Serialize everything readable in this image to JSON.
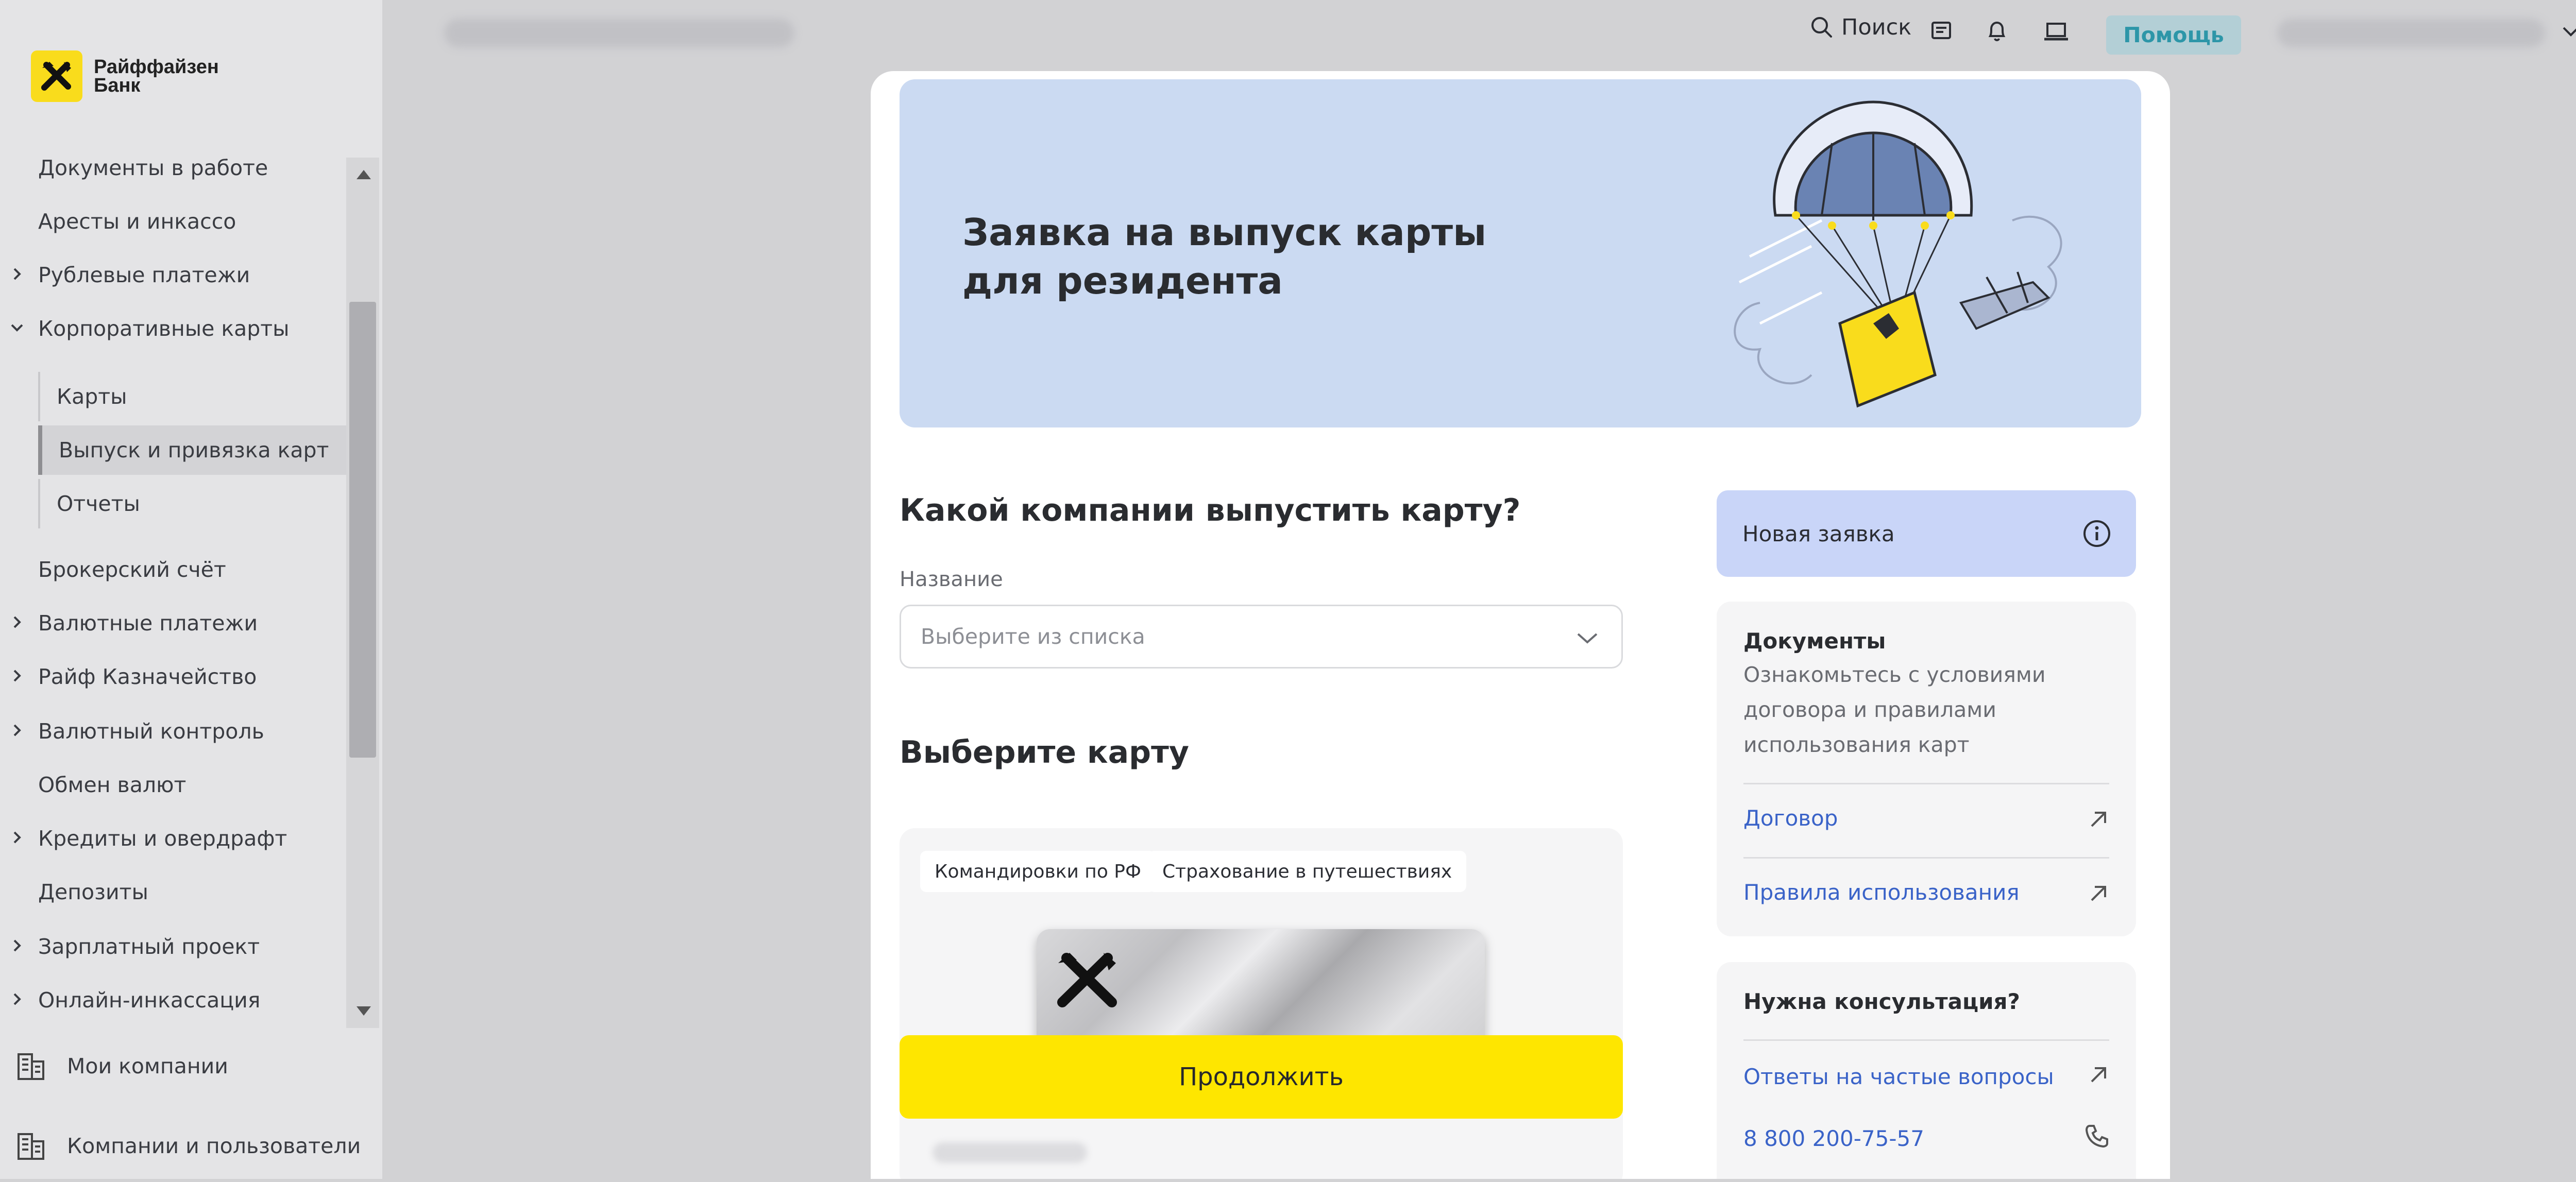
{
  "brand": {
    "name_line1": "Райффайзен",
    "name_line2": "Банк",
    "color": "#f9dc1c"
  },
  "sidebar": {
    "items": [
      {
        "label": "Документы в работе",
        "expandable": false
      },
      {
        "label": "Аресты и инкассо",
        "expandable": false
      },
      {
        "label": "Рублевые платежи",
        "expandable": true,
        "expanded": false
      },
      {
        "label": "Корпоративные карты",
        "expandable": true,
        "expanded": true
      }
    ],
    "subitems": [
      {
        "label": "Карты",
        "active": false
      },
      {
        "label": "Выпуск и привязка карт",
        "active": true
      },
      {
        "label": "Отчеты",
        "active": false
      }
    ],
    "items_after": [
      {
        "label": "Брокерский счёт",
        "expandable": false
      },
      {
        "label": "Валютные платежи",
        "expandable": true
      },
      {
        "label": "Райф Казначейство",
        "expandable": true
      },
      {
        "label": "Валютный контроль",
        "expandable": true
      },
      {
        "label": "Обмен валют",
        "expandable": false
      },
      {
        "label": "Кредиты и овердрафт",
        "expandable": true
      },
      {
        "label": "Депозиты",
        "expandable": false
      },
      {
        "label": "Зарплатный проект",
        "expandable": true
      },
      {
        "label": "Онлайн-инкассация",
        "expandable": true
      }
    ],
    "bottom": [
      {
        "label": "Мои компании",
        "icon": "building-icon"
      },
      {
        "label": "Компании и пользователи",
        "icon": "building-icon"
      }
    ]
  },
  "topbar": {
    "search_label": "Поиск",
    "help_label": "Помощь",
    "icons": [
      "search-icon",
      "chat-icon",
      "bell-icon",
      "laptop-icon",
      "chevron-down-icon"
    ]
  },
  "modal": {
    "banner_title_line1": "Заявка на выпуск карты",
    "banner_title_line2": "для резидента",
    "company_heading": "Какой компании выпустить карту?",
    "name_label": "Название",
    "name_placeholder": "Выберите из списка",
    "card_heading": "Выберите карту",
    "tags": [
      "Командировки по РФ",
      "Страхование в путешествиях"
    ],
    "continue_label": "Продолжить",
    "new_request_label": "Новая заявка",
    "docs": {
      "title": "Документы",
      "description": "Ознакомьтесь с условиями договора и правилами использования карт",
      "links": [
        "Договор",
        "Правила использования"
      ]
    },
    "consult": {
      "title": "Нужна консультация?",
      "faq_link": "Ответы на частые вопросы",
      "phone": "8 800 200-75-57"
    }
  },
  "colors": {
    "accent_yellow": "#fee600",
    "banner_blue": "#cbdaf2",
    "new_request_blue": "#c9d5f8",
    "link_blue": "#3a63c8",
    "help_teal": "#2d96a8"
  }
}
